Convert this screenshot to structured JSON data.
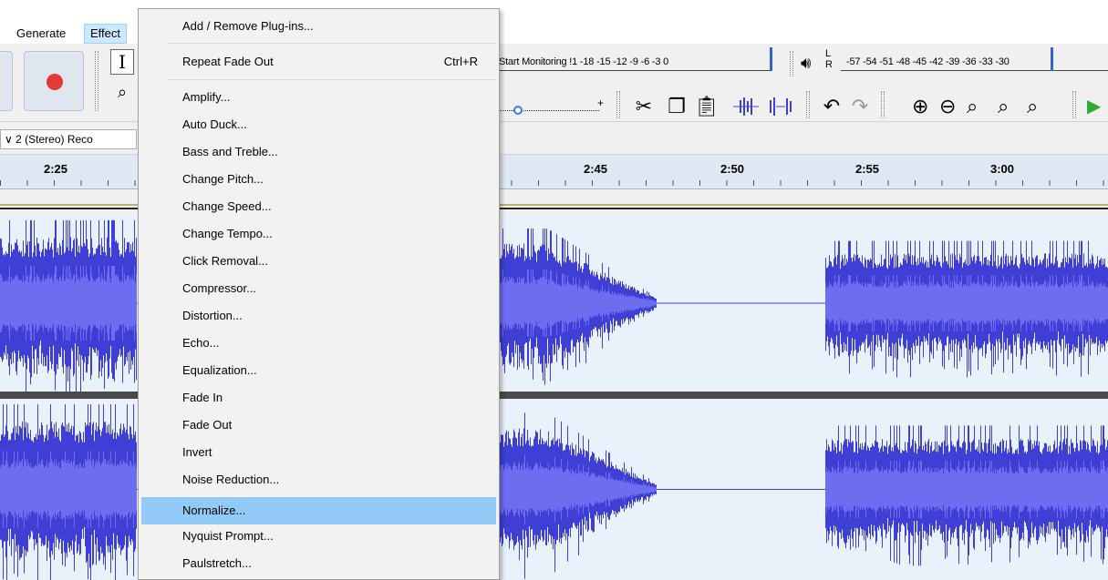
{
  "menubar": {
    "generate": "Generate",
    "effect": "Effect"
  },
  "toolbar": {
    "monitor_text": "Start Monitoring !1 -18 -15 -12  -9   -6   -3   0",
    "meter_left": "L",
    "meter_right": "R",
    "meter_scale": "-57 -54 -51 -48 -45 -42 -39 -36 -33 -30",
    "slider_plus": "+",
    "icons": [
      "record-icon",
      "ibeam-icon",
      "zoom-tool-icon",
      "speaker-icon",
      "cut-icon",
      "copy-icon",
      "paste-icon",
      "trim-icon",
      "silence-icon",
      "undo-icon",
      "redo-icon",
      "zoom-in-icon",
      "zoom-out-icon",
      "fit-selection-icon",
      "fit-project-icon",
      "zoom-toggle-icon",
      "play-icon"
    ]
  },
  "track_toolbar": {
    "channels": "2 (Stereo) Reco"
  },
  "ruler": {
    "labels": [
      "2:25",
      "2:45",
      "2:50",
      "2:55",
      "3:00"
    ]
  },
  "effect_menu": {
    "items": [
      {
        "label": "Add / Remove Plug-ins...",
        "shortcut": ""
      },
      {
        "label": "Repeat Fade Out",
        "shortcut": "Ctrl+R"
      },
      {
        "label": "Amplify...",
        "shortcut": ""
      },
      {
        "label": "Auto Duck...",
        "shortcut": ""
      },
      {
        "label": "Bass and Treble...",
        "shortcut": ""
      },
      {
        "label": "Change Pitch...",
        "shortcut": ""
      },
      {
        "label": "Change Speed...",
        "shortcut": ""
      },
      {
        "label": "Change Tempo...",
        "shortcut": ""
      },
      {
        "label": "Click Removal...",
        "shortcut": ""
      },
      {
        "label": "Compressor...",
        "shortcut": ""
      },
      {
        "label": "Distortion...",
        "shortcut": ""
      },
      {
        "label": "Echo...",
        "shortcut": ""
      },
      {
        "label": "Equalization...",
        "shortcut": ""
      },
      {
        "label": "Fade In",
        "shortcut": ""
      },
      {
        "label": "Fade Out",
        "shortcut": ""
      },
      {
        "label": "Invert",
        "shortcut": ""
      },
      {
        "label": "Noise Reduction...",
        "shortcut": ""
      },
      {
        "label": "Normalize...",
        "shortcut": ""
      },
      {
        "label": "Nyquist Prompt...",
        "shortcut": ""
      },
      {
        "label": "Paulstretch...",
        "shortcut": ""
      }
    ],
    "highlighted": "Normalize..."
  },
  "colors": {
    "waveform": "#3f3fd6",
    "waveform_rms": "#6d6df0",
    "track_bg": "#e9f1fb",
    "highlight": "#91c9f7",
    "record": "#e53935",
    "play": "#2eaa2e"
  }
}
